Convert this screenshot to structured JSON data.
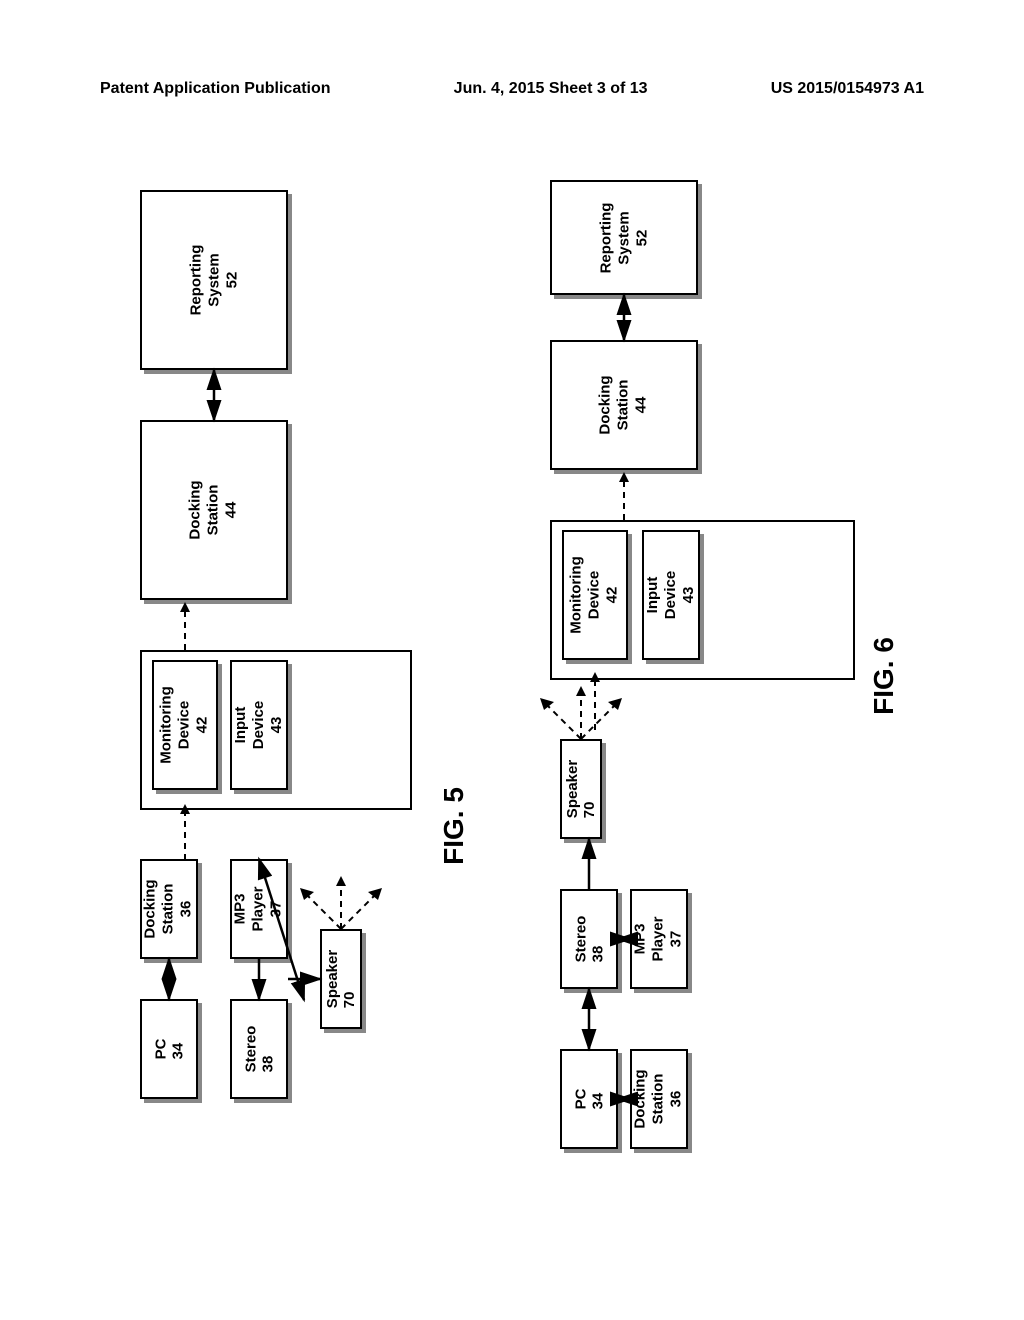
{
  "header": {
    "left": "Patent Application Publication",
    "center": "Jun. 4, 2015   Sheet 3 of 13",
    "right": "US 2015/0154973 A1"
  },
  "fig5": {
    "label": "FIG. 5",
    "pc": {
      "name": "PC",
      "num": "34"
    },
    "docking1": {
      "name": "Docking\nStation",
      "num": "36"
    },
    "stereo": {
      "name": "Stereo",
      "num": "38"
    },
    "mp3": {
      "name": "MP3\nPlayer",
      "num": "37"
    },
    "speaker": {
      "name": "Speaker",
      "num": "70"
    },
    "monitoring": {
      "name": "Monitoring\nDevice",
      "num": "42"
    },
    "input": {
      "name": "Input\nDevice",
      "num": "43"
    },
    "docking2": {
      "name": "Docking\nStation",
      "num": "44"
    },
    "reporting": {
      "name": "Reporting\nSystem",
      "num": "52"
    }
  },
  "fig6": {
    "label": "FIG. 6",
    "pc": {
      "name": "PC",
      "num": "34"
    },
    "docking1": {
      "name": "Docking\nStation",
      "num": "36"
    },
    "stereo": {
      "name": "Stereo",
      "num": "38"
    },
    "mp3": {
      "name": "MP3\nPlayer",
      "num": "37"
    },
    "speaker": {
      "name": "Speaker",
      "num": "70"
    },
    "monitoring": {
      "name": "Monitoring\nDevice",
      "num": "42"
    },
    "input": {
      "name": "Input\nDevice",
      "num": "43"
    },
    "docking2": {
      "name": "Docking\nStation",
      "num": "44"
    },
    "reporting": {
      "name": "Reporting\nSystem",
      "num": "52"
    }
  }
}
